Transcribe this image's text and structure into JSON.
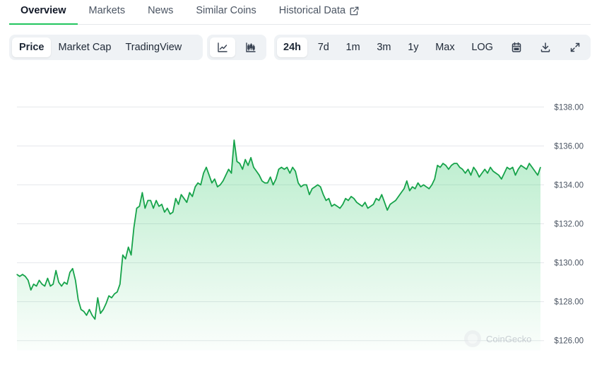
{
  "tabs": [
    {
      "label": "Overview",
      "active": true
    },
    {
      "label": "Markets",
      "active": false
    },
    {
      "label": "News",
      "active": false
    },
    {
      "label": "Similar Coins",
      "active": false
    },
    {
      "label": "Historical Data",
      "active": false,
      "icon": "external-link-icon"
    }
  ],
  "toolbar": {
    "chart_types": [
      {
        "label": "Price",
        "active": true
      },
      {
        "label": "Market Cap",
        "active": false
      },
      {
        "label": "TradingView",
        "active": false
      }
    ],
    "chart_styles": [
      {
        "icon": "line-chart-icon",
        "active": true
      },
      {
        "icon": "candlestick-chart-icon",
        "active": false
      }
    ],
    "ranges": [
      {
        "label": "24h",
        "active": true
      },
      {
        "label": "7d",
        "active": false
      },
      {
        "label": "1m",
        "active": false
      },
      {
        "label": "3m",
        "active": false
      },
      {
        "label": "1y",
        "active": false
      },
      {
        "label": "Max",
        "active": false
      },
      {
        "label": "LOG",
        "active": false
      }
    ],
    "tool_icons": [
      "calendar-icon",
      "download-icon",
      "expand-icon"
    ]
  },
  "watermark": "CoinGecko",
  "colors": {
    "accent": "#22c55e",
    "line": "#16a34a",
    "grid": "#e5e7eb",
    "axis_text": "#4b5563"
  },
  "chart_data": {
    "type": "area",
    "xlabel": "",
    "ylabel": "",
    "ylim": [
      125.5,
      138.5
    ],
    "yticks": [
      126,
      128,
      130,
      132,
      134,
      136,
      138
    ],
    "ytick_labels": [
      "$126.00",
      "$128.00",
      "$130.00",
      "$132.00",
      "$134.00",
      "$136.00",
      "$138.00"
    ],
    "grid": true,
    "series": [
      {
        "values": [
          129.4,
          129.3,
          129.4,
          129.3,
          129.1,
          128.6,
          128.9,
          128.8,
          129.1,
          128.9,
          128.8,
          129.2,
          128.8,
          128.9,
          129.6,
          129.0,
          128.8,
          129.0,
          128.9,
          129.5,
          129.7,
          129.1,
          128.1,
          127.6,
          127.5,
          127.3,
          127.6,
          127.3,
          127.1,
          128.2,
          127.4,
          127.6,
          127.9,
          128.3,
          128.2,
          128.4,
          128.5,
          128.9,
          130.4,
          130.2,
          130.8,
          130.4,
          131.8,
          132.8,
          132.9,
          133.6,
          132.8,
          133.2,
          133.2,
          132.8,
          133.2,
          132.9,
          133.0,
          132.6,
          132.8,
          132.5,
          132.6,
          133.3,
          133.0,
          133.5,
          133.3,
          133.1,
          133.6,
          133.4,
          133.9,
          134.1,
          134.0,
          134.6,
          134.9,
          134.5,
          134.1,
          134.3,
          133.9,
          134.0,
          134.2,
          134.5,
          134.8,
          134.6,
          136.3,
          135.2,
          135.1,
          134.8,
          135.3,
          135.0,
          135.4,
          134.9,
          134.7,
          134.5,
          134.2,
          134.1,
          134.1,
          134.4,
          134.0,
          134.3,
          134.8,
          134.9,
          134.8,
          134.9,
          134.6,
          134.9,
          134.7,
          134.1,
          133.9,
          134.0,
          134.0,
          133.5,
          133.8,
          133.9,
          134.0,
          133.9,
          133.5,
          133.2,
          133.3,
          132.9,
          133.0,
          132.9,
          132.8,
          133.0,
          133.3,
          133.2,
          133.4,
          133.3,
          133.1,
          133.0,
          132.9,
          133.1,
          132.8,
          132.9,
          133.0,
          133.3,
          133.2,
          133.5,
          133.1,
          132.7,
          133.0,
          133.1,
          133.2,
          133.4,
          133.6,
          133.8,
          134.2,
          133.7,
          133.9,
          133.8,
          134.1,
          133.9,
          134.0,
          133.9,
          133.8,
          134.0,
          134.3,
          135.0,
          134.9,
          135.1,
          135.0,
          134.8,
          135.0,
          135.1,
          135.1,
          134.9,
          134.8,
          134.6,
          134.8,
          134.5,
          134.9,
          134.7,
          134.4,
          134.6,
          134.8,
          134.6,
          134.9,
          134.7,
          134.6,
          134.5,
          134.3,
          134.6,
          134.9,
          134.8,
          134.9,
          134.5,
          134.8,
          135.0,
          134.9,
          134.8,
          135.1,
          134.9,
          134.7,
          134.5,
          134.9
        ]
      }
    ]
  }
}
